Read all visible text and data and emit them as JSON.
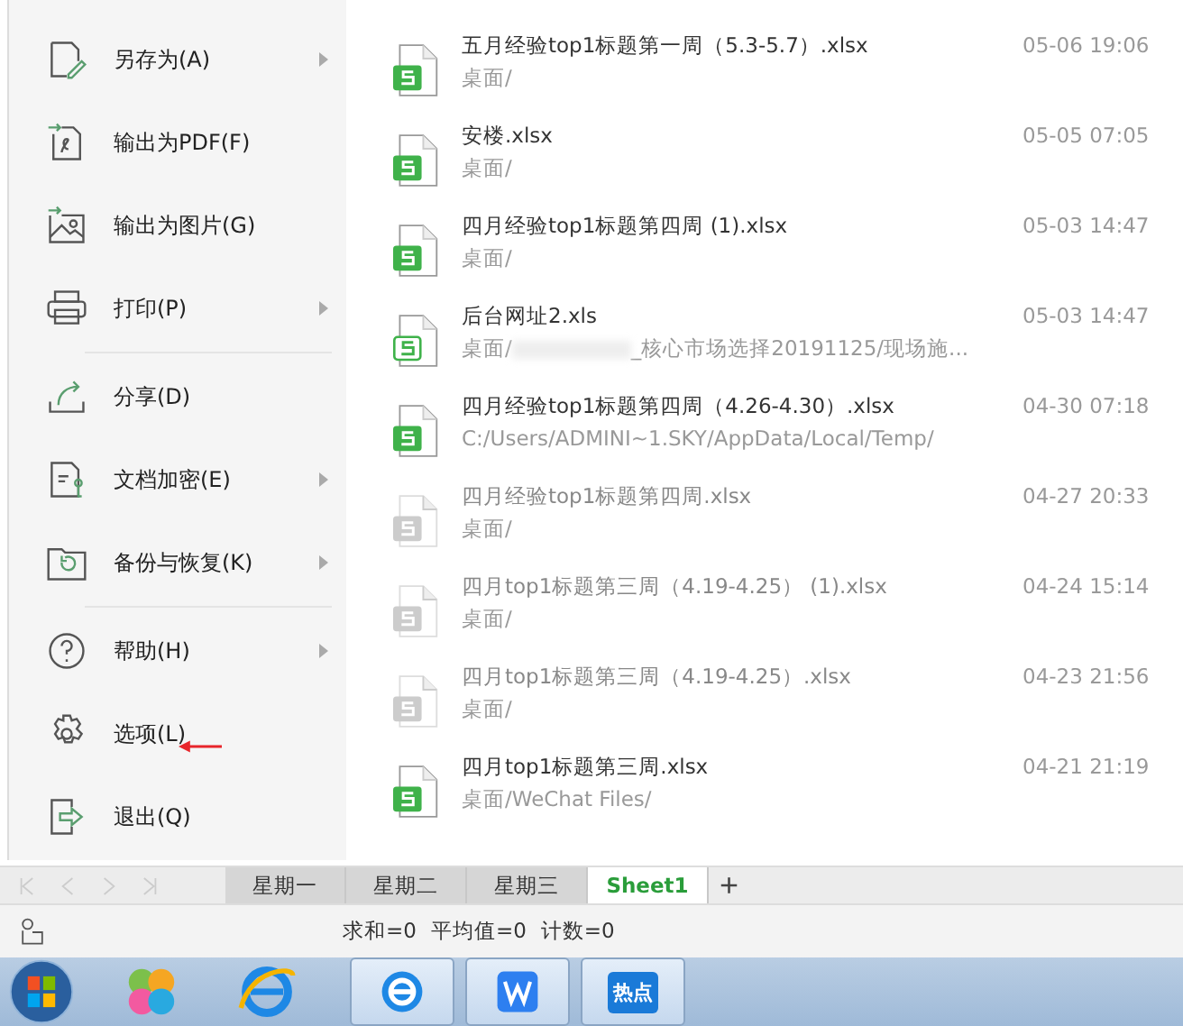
{
  "menu": {
    "groups": [
      {
        "items": [
          {
            "label": "另存为(A)",
            "kind": "save-as",
            "submenu": true
          },
          {
            "label": "输出为PDF(F)",
            "kind": "pdf",
            "submenu": false
          },
          {
            "label": "输出为图片(G)",
            "kind": "image",
            "submenu": false
          },
          {
            "label": "打印(P)",
            "kind": "print",
            "submenu": true
          }
        ]
      },
      {
        "items": [
          {
            "label": "分享(D)",
            "kind": "share",
            "submenu": false
          },
          {
            "label": "文档加密(E)",
            "kind": "encrypt",
            "submenu": true
          },
          {
            "label": "备份与恢复(K)",
            "kind": "backup",
            "submenu": true
          }
        ]
      },
      {
        "items": [
          {
            "label": "帮助(H)",
            "kind": "help",
            "submenu": true
          },
          {
            "label": "选项(L)",
            "kind": "options",
            "submenu": false,
            "annotated": true
          },
          {
            "label": "退出(Q)",
            "kind": "exit",
            "submenu": false
          }
        ]
      }
    ]
  },
  "recent_files": [
    {
      "name": "五月经验top1标题第一周（5.3-5.7）.xlsx",
      "path": "桌面/",
      "time": "05-06 19:06",
      "kind": "solid",
      "dimmed": false
    },
    {
      "name": "安楼.xlsx",
      "path": "桌面/",
      "time": "05-05 07:05",
      "kind": "solid",
      "dimmed": false
    },
    {
      "name": "四月经验top1标题第四周 (1).xlsx",
      "path": "桌面/",
      "time": "05-03 14:47",
      "kind": "solid",
      "dimmed": false
    },
    {
      "name": "后台网址2.xls",
      "path": "桌面/",
      "path_tail": "_核心市场选择20191125/现场施...",
      "redacted": true,
      "time": "05-03 14:47",
      "kind": "outline",
      "dimmed": false
    },
    {
      "name": "四月经验top1标题第四周（4.26-4.30）.xlsx",
      "path": "C:/Users/ADMINI~1.SKY/AppData/Local/Temp/",
      "time": "04-30 07:18",
      "kind": "solid",
      "dimmed": false
    },
    {
      "name": "四月经验top1标题第四周.xlsx",
      "path": "桌面/",
      "time": "04-27 20:33",
      "kind": "faded",
      "dimmed": true
    },
    {
      "name": "四月top1标题第三周（4.19-4.25） (1).xlsx",
      "path": "桌面/",
      "time": "04-24 15:14",
      "kind": "faded",
      "dimmed": true
    },
    {
      "name": "四月top1标题第三周（4.19-4.25）.xlsx",
      "path": "桌面/",
      "time": "04-23 21:56",
      "kind": "faded",
      "dimmed": true
    },
    {
      "name": "四月top1标题第三周.xlsx",
      "path": "桌面/WeChat Files/",
      "time": "04-21 21:19",
      "kind": "solid",
      "dimmed": false
    }
  ],
  "sheet_tabs": [
    {
      "label": "星期一",
      "selected": false
    },
    {
      "label": "星期二",
      "selected": false
    },
    {
      "label": "星期三",
      "selected": false
    },
    {
      "label": "Sheet1",
      "selected": true
    }
  ],
  "add_sheet": "+",
  "status_bar": {
    "stats": [
      "求和=0",
      "平均值=0",
      "计数=0"
    ]
  },
  "taskbar": {
    "hot_label": "热点"
  }
}
